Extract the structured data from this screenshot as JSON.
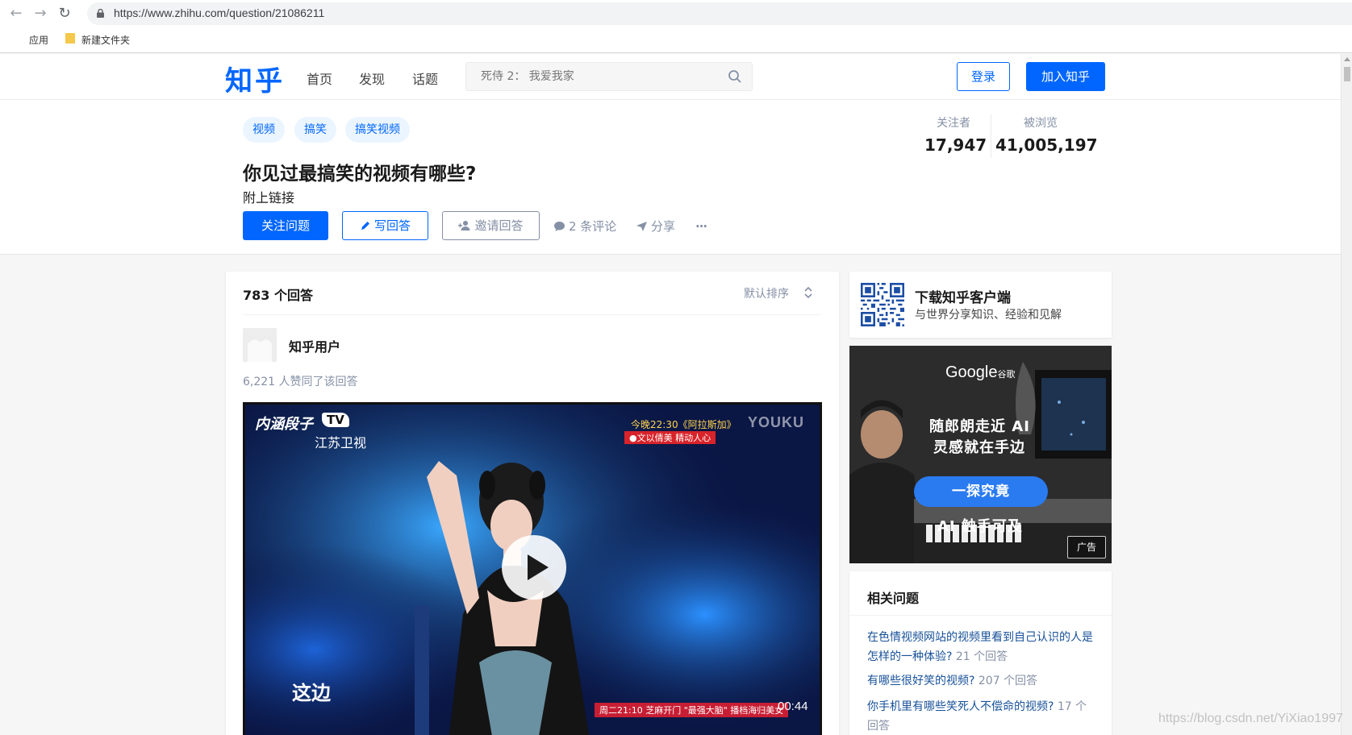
{
  "browser": {
    "url": "https://www.zhihu.com/question/21086211",
    "bookmarks": [
      {
        "label": "应用",
        "icon": "apps-grid-icon"
      },
      {
        "label": "新建文件夹",
        "icon": "folder-icon"
      }
    ]
  },
  "header": {
    "logo": "知乎",
    "nav": [
      "首页",
      "发现",
      "话题"
    ],
    "search_placeholder": "死侍 2： 我爱我家",
    "login": "登录",
    "join": "加入知乎",
    "brand_color": "#0066ff"
  },
  "question": {
    "tags": [
      "视频",
      "搞笑",
      "搞笑视频"
    ],
    "title": "你见过最搞笑的视频有哪些?",
    "detail": "附上链接",
    "follow_button": "关注问题",
    "write_button": "写回答",
    "invite_button": "邀请回答",
    "comments": "2 条评论",
    "share": "分享",
    "more": "···",
    "stats": {
      "followers_label": "关注者",
      "followers_value": "17,947",
      "views_label": "被浏览",
      "views_value": "41,005,197"
    }
  },
  "answers": {
    "count": "783 个回答",
    "sort": "默认排序",
    "first": {
      "author": "知乎用户",
      "votes": "6,221 人赞同了该回答",
      "video": {
        "duration": "00:44",
        "watermark_show": "内涵段子",
        "watermark_tv": "TV",
        "watermark_channel": "江苏卫视",
        "watermark_youku": "YOUKU",
        "promo_line1": "今晚22:30《阿拉斯加》",
        "promo_line2": "●文以倩美  精动人心",
        "subtitle": "这边",
        "bottom_banner": "周二21:10 芝麻开门 \"最强大脑\" 播档海归美女"
      }
    }
  },
  "sidebar": {
    "app_title": "下载知乎客户端",
    "app_subtitle": "与世界分享知识、经验和见解",
    "ad": {
      "brand": "Google",
      "brand_cn": "谷歌",
      "line1": "随郎朗走近 AI",
      "line2": "灵感就在手边",
      "cta": "一探究竟",
      "line3": "AI 触手可及",
      "tag": "广告"
    },
    "related_title": "相关问题",
    "related": [
      {
        "q": "在色情视频网站的视频里看到自己认识的人是怎样的一种体验?",
        "count": "21 个回答"
      },
      {
        "q": "有哪些很好笑的视频?",
        "count": "207 个回答"
      },
      {
        "q": "你手机里有哪些笑死人不偿命的视频?",
        "count": "17 个回答"
      }
    ]
  },
  "watermark": "https://blog.csdn.net/YiXiao1997"
}
